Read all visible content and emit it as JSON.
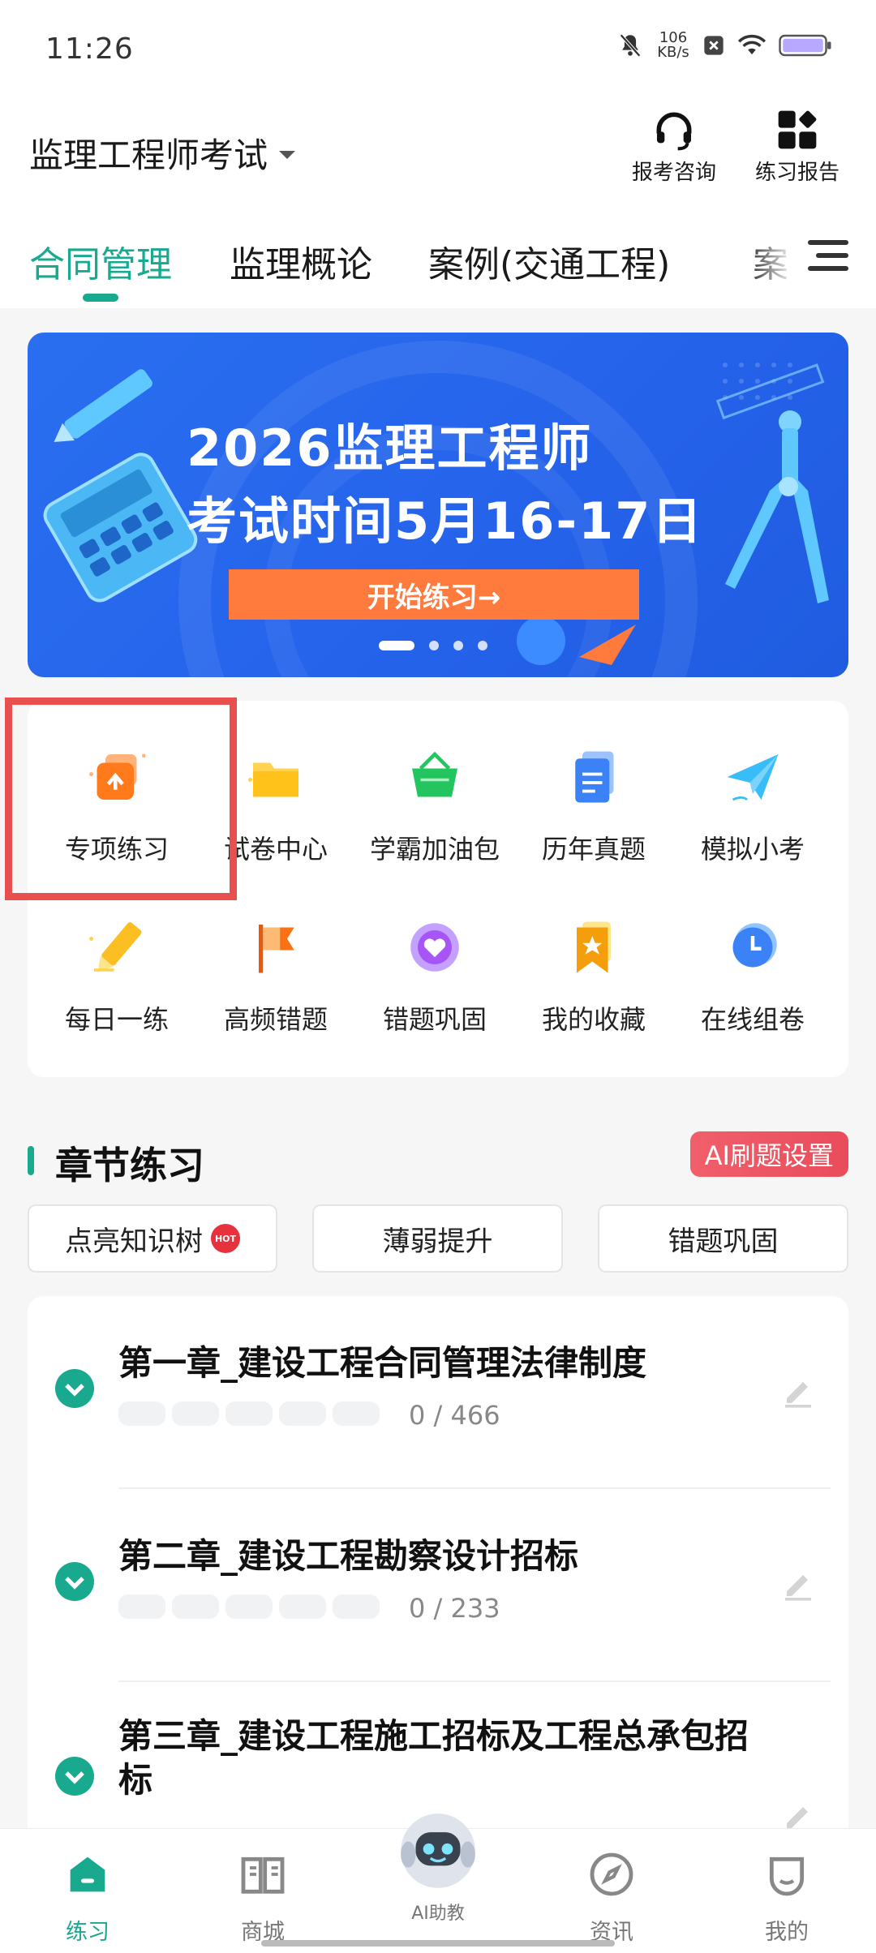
{
  "status_bar": {
    "time": "11:26",
    "speed_value": "106",
    "speed_unit": "KB/s"
  },
  "header": {
    "exam_title": "监理工程师考试",
    "actions": [
      {
        "label": "报考咨询",
        "icon": "headset-icon"
      },
      {
        "label": "练习报告",
        "icon": "grid-report-icon"
      }
    ]
  },
  "tabs": {
    "items": [
      {
        "label": "合同管理",
        "active": true
      },
      {
        "label": "监理概论",
        "active": false
      },
      {
        "label": "案例(交通工程)",
        "active": false
      },
      {
        "label": "案",
        "active": false
      }
    ]
  },
  "banner": {
    "line1": "2026监理工程师",
    "line2": "考试时间5月16-17日",
    "cta": "开始练习→",
    "pages": 4,
    "current_page": 1
  },
  "features": {
    "items": [
      {
        "label": "专项练习",
        "icon": "special-practice-icon",
        "color": "#ff7a1a"
      },
      {
        "label": "试卷中心",
        "icon": "folder-icon",
        "color": "#ffc21a"
      },
      {
        "label": "学霸加油包",
        "icon": "basket-icon",
        "color": "#22c55e"
      },
      {
        "label": "历年真题",
        "icon": "document-icon",
        "color": "#3b82f6"
      },
      {
        "label": "模拟小考",
        "icon": "paper-plane-icon",
        "color": "#38bdf8"
      },
      {
        "label": "每日一练",
        "icon": "pencil-icon",
        "color": "#fbbf24"
      },
      {
        "label": "高频错题",
        "icon": "flag-icon",
        "color": "#f97316"
      },
      {
        "label": "错题巩固",
        "icon": "heart-icon",
        "color": "#a855f7"
      },
      {
        "label": "我的收藏",
        "icon": "bookmark-star-icon",
        "color": "#f59e0b"
      },
      {
        "label": "在线组卷",
        "icon": "clock-icon",
        "color": "#3b82f6"
      }
    ]
  },
  "section": {
    "title": "章节练习",
    "ai_button": "AI刷题设置",
    "filters": [
      {
        "label": "点亮知识树",
        "hot_badge": "HOT"
      },
      {
        "label": "薄弱提升"
      },
      {
        "label": "错题巩固"
      }
    ]
  },
  "chapters": [
    {
      "title": "第一章_建设工程合同管理法律制度",
      "progress": "0 / 466"
    },
    {
      "title": "第二章_建设工程勘察设计招标",
      "progress": "0 / 233"
    },
    {
      "title": "第三章_建设工程施工招标及工程总承包招标",
      "progress": ""
    }
  ],
  "bottom_nav": {
    "items": [
      {
        "label": "练习",
        "icon": "home-icon",
        "active": true
      },
      {
        "label": "商城",
        "icon": "book-icon",
        "active": false
      },
      {
        "label": "AI助教",
        "icon": "robot-icon",
        "active": false
      },
      {
        "label": "资讯",
        "icon": "compass-icon",
        "active": false
      },
      {
        "label": "我的",
        "icon": "face-icon",
        "active": false
      }
    ]
  },
  "theme": {
    "accent": "#19a98e",
    "banner": "#2563eb",
    "cta": "#ff7a3d",
    "highlight_box": "#e8504f"
  }
}
